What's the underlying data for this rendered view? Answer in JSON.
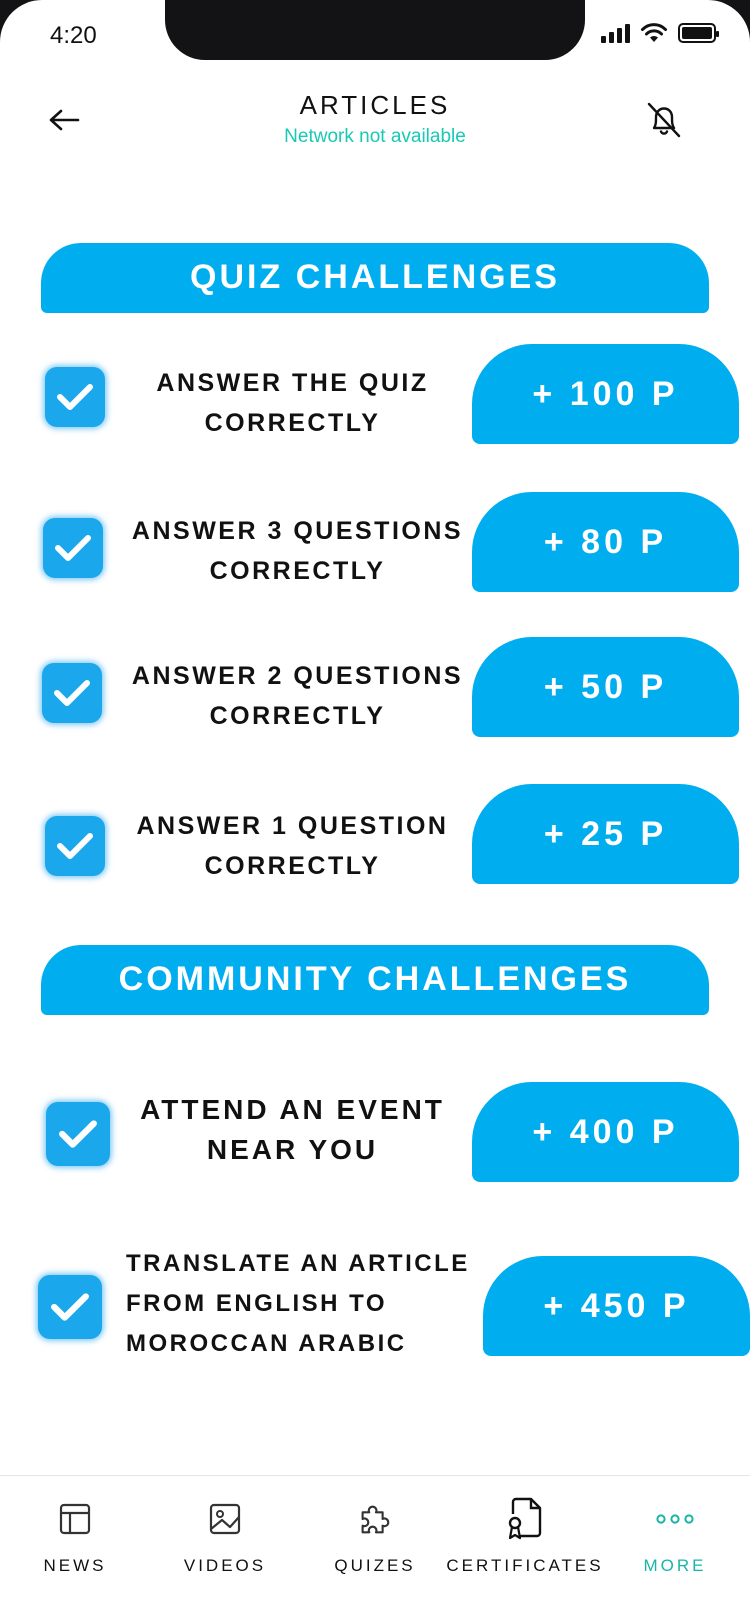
{
  "status_bar": {
    "time": "4:20"
  },
  "header": {
    "title": "ARTICLES",
    "subtitle": "Network not available"
  },
  "sections": {
    "quiz": {
      "title": "QUIZ CHALLENGES"
    },
    "community": {
      "title": "COMMUNITY  CHALLENGES"
    }
  },
  "quiz_challenges": [
    {
      "label": "ANSWER  THE QUIZ\nCORRECTLY",
      "points": "+ 100 P",
      "checked": true
    },
    {
      "label": "ANSWER 3 QUESTIONS\nCORRECTLY",
      "points": "+ 80 P",
      "checked": true
    },
    {
      "label": "ANSWER 2 QUESTIONS\nCORRECTLY",
      "points": "+ 50 P",
      "checked": true
    },
    {
      "label": "ANSWER 1 QUESTION\nCORRECTLY",
      "points": "+ 25 P",
      "checked": true
    }
  ],
  "community_challenges": [
    {
      "label": "ATTEND AN EVENT\nNEAR YOU",
      "points": "+ 400 P",
      "checked": true
    },
    {
      "label": "TRANSLATE AN ARTICLE\n FROM ENGLISH TO\nMOROCCAN ARABIC",
      "points": "+ 450 P",
      "checked": true
    }
  ],
  "bottom_nav": [
    {
      "label": "NEWS",
      "icon": "news-icon"
    },
    {
      "label": "VIDEOS",
      "icon": "image-icon"
    },
    {
      "label": "QUIZES",
      "icon": "puzzle-icon"
    },
    {
      "label": "CERTIFICATES",
      "icon": "certificate-icon"
    },
    {
      "label": "MORE",
      "icon": "more-icon",
      "active": true
    }
  ],
  "colors": {
    "accent": "#00aeef",
    "teal": "#18c9b4",
    "nav_active": "#18b5a8"
  }
}
